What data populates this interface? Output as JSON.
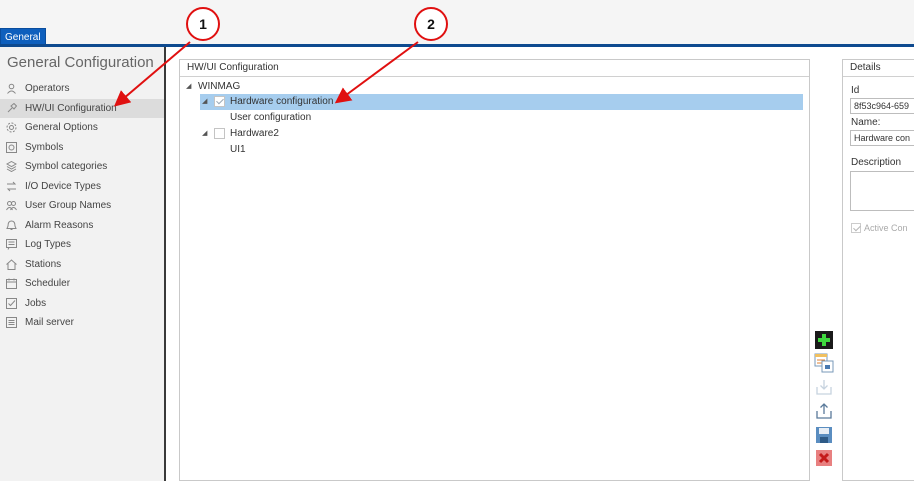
{
  "tab": {
    "label": "General"
  },
  "sidebar": {
    "title": "General Configuration",
    "items": [
      {
        "label": "Operators",
        "icon": "operators-icon"
      },
      {
        "label": "HW/UI Configuration",
        "icon": "hwui-config-icon",
        "active": true
      },
      {
        "label": "General Options",
        "icon": "general-options-icon"
      },
      {
        "label": "Symbols",
        "icon": "symbols-icon"
      },
      {
        "label": "Symbol categories",
        "icon": "symbol-categories-icon"
      },
      {
        "label": "I/O Device Types",
        "icon": "io-device-types-icon"
      },
      {
        "label": "User Group Names",
        "icon": "user-group-names-icon"
      },
      {
        "label": "Alarm Reasons",
        "icon": "alarm-reasons-icon"
      },
      {
        "label": "Log Types",
        "icon": "log-types-icon"
      },
      {
        "label": "Stations",
        "icon": "stations-icon"
      },
      {
        "label": "Scheduler",
        "icon": "scheduler-icon"
      },
      {
        "label": "Jobs",
        "icon": "jobs-icon"
      },
      {
        "label": "Mail server",
        "icon": "mail-server-icon"
      }
    ]
  },
  "tree_panel": {
    "header": "HW/UI Configuration",
    "nodes": {
      "root": "WINMAG",
      "hw1": "Hardware configuration",
      "ui_config": "User configuration",
      "hw2": "Hardware2",
      "ui1": "UI1"
    }
  },
  "details": {
    "header": "Details",
    "id_label": "Id",
    "id_value": "8f53c964-659",
    "name_label": "Name:",
    "name_value": "Hardware con",
    "description_label": "Description",
    "active_label": "Active Con"
  },
  "actions": [
    "add-icon",
    "copy-icon",
    "import-icon",
    "export-icon",
    "save-icon",
    "delete-icon"
  ],
  "callouts": {
    "one": "1",
    "two": "2"
  },
  "colors": {
    "accent": "#0e5fbd",
    "selection": "#a6cdee",
    "callout": "#e01010"
  }
}
